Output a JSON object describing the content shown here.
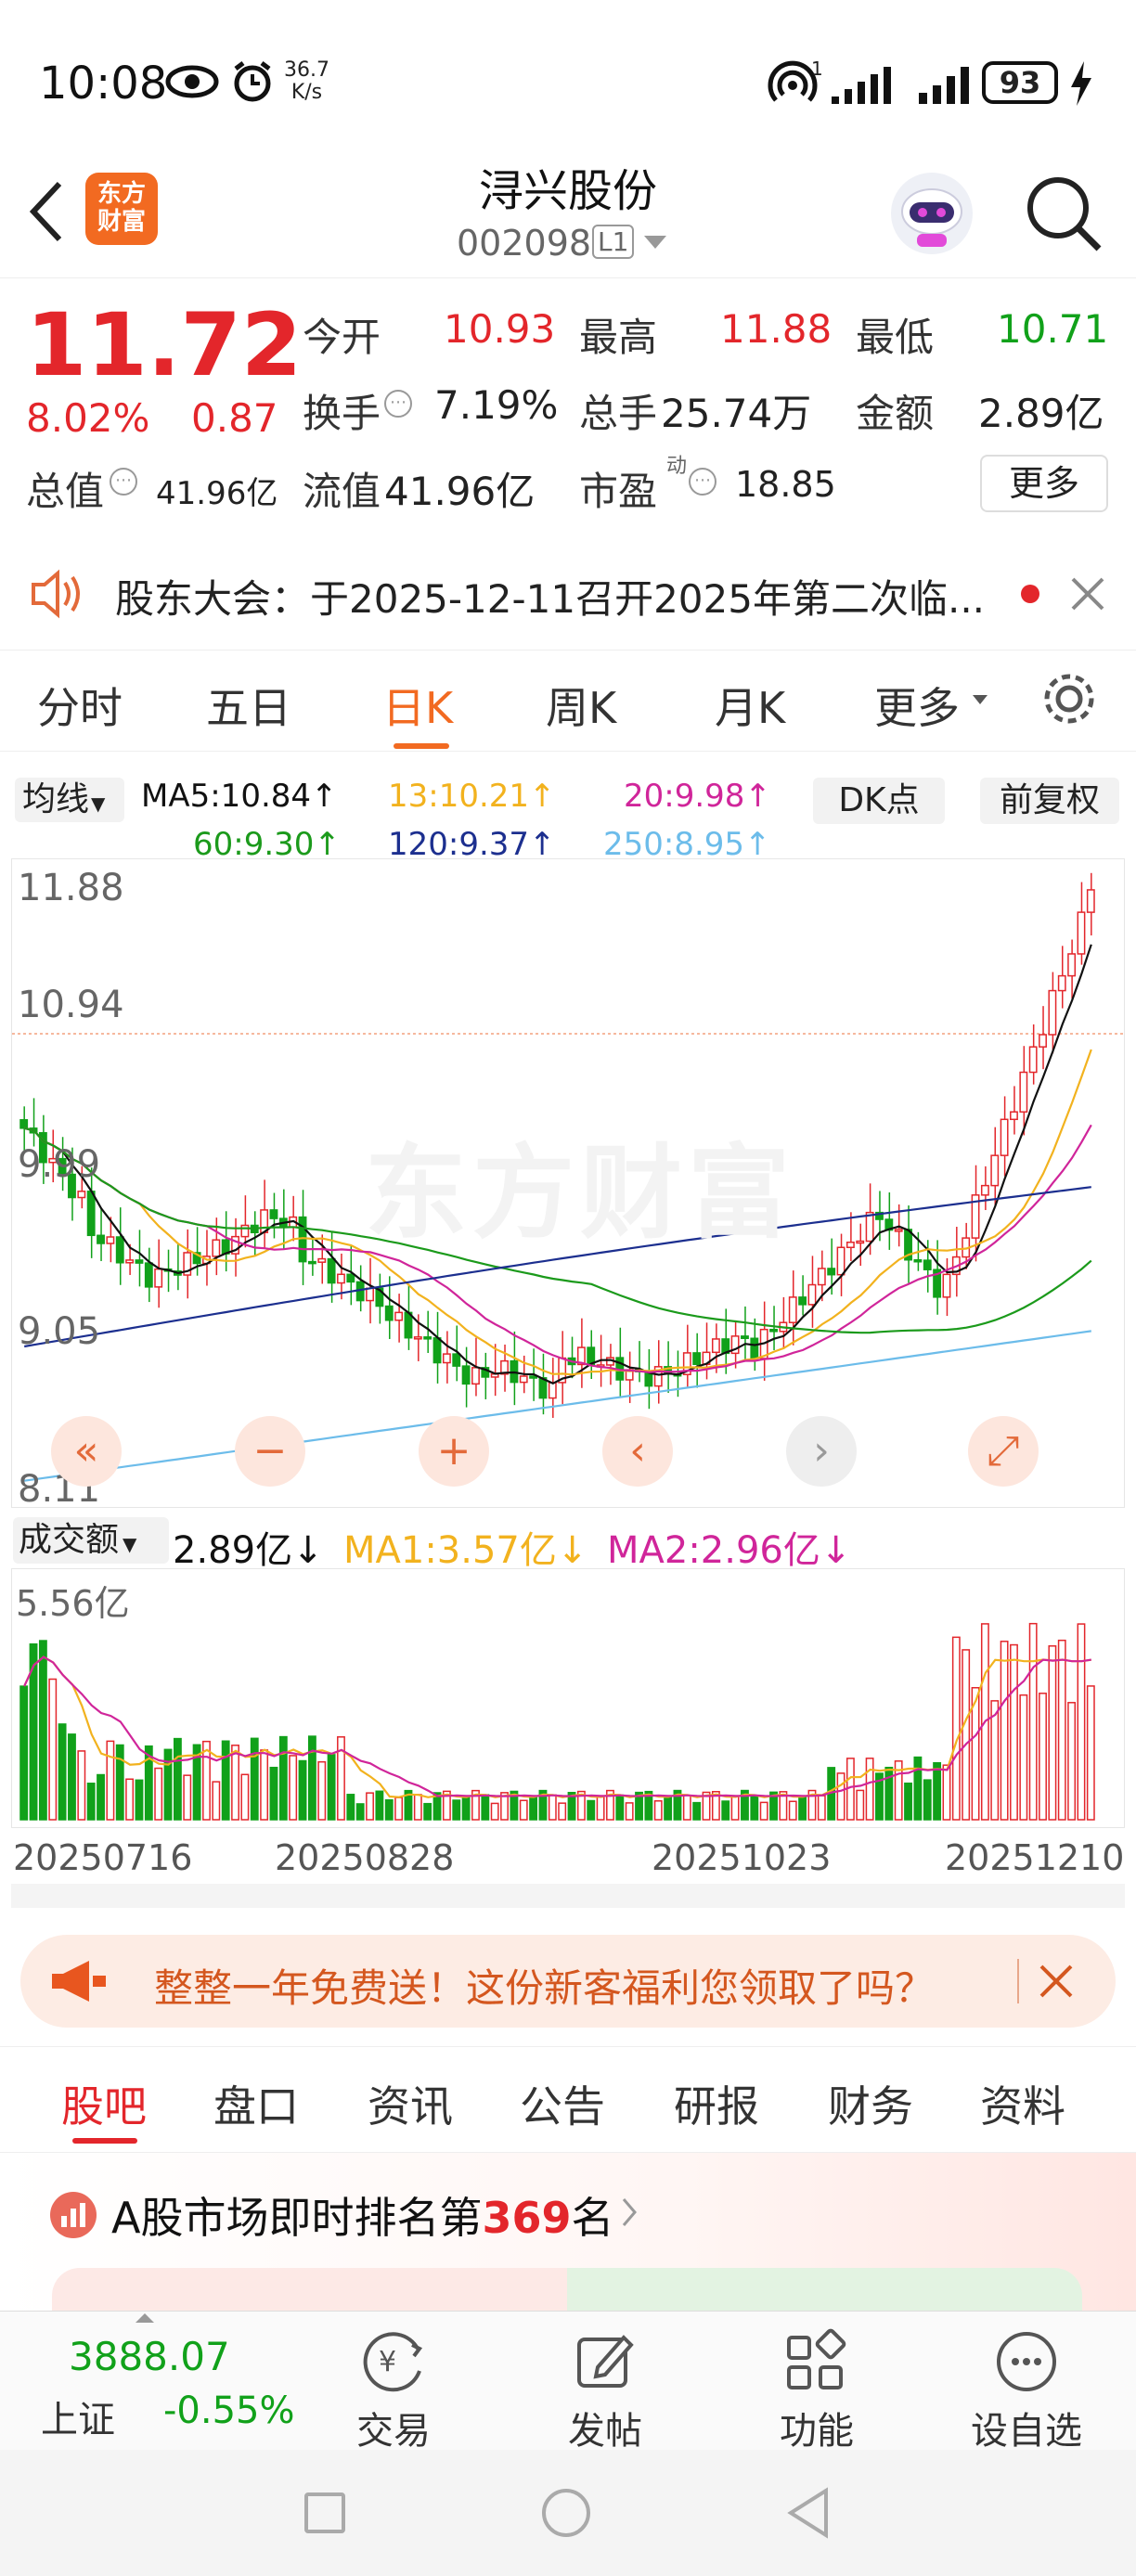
{
  "status": {
    "time": "10:08",
    "net_speed_top": "36.7",
    "net_speed_bottom": "K/s",
    "battery": "93",
    "signal_sup": "1"
  },
  "header": {
    "logo_line1": "东方",
    "logo_line2": "财富",
    "title": "浔兴股份",
    "code": "002098",
    "level": "L1"
  },
  "quote": {
    "price": "11.72",
    "pct": "8.02%",
    "change": "0.87",
    "open_label": "今开",
    "open": "10.93",
    "high_label": "最高",
    "high": "11.88",
    "low_label": "最低",
    "low": "10.71",
    "turnover_label": "换手",
    "turnover": "7.19%",
    "volume_label": "总手",
    "volume": "25.74万",
    "amount_label": "金额",
    "amount": "2.89亿",
    "mcap_label": "总值",
    "mcap": "41.96亿",
    "float_label": "流值",
    "float": "41.96亿",
    "pe_label": "市盈",
    "pe_sup": "动",
    "pe": "18.85",
    "more": "更多"
  },
  "notice": {
    "text": "股东大会：于2025-12-11召开2025年第二次临..."
  },
  "ktabs": [
    "分时",
    "五日",
    "日K",
    "周K",
    "月K",
    "更多"
  ],
  "ma": {
    "select": "均线",
    "ma5": "MA5:10.84↑",
    "ma13": "13:10.21↑",
    "ma20": "20:9.98↑",
    "ma60": "60:9.30↑",
    "ma120": "120:9.37↑",
    "ma250": "250:8.95↑",
    "dk": "DK点",
    "fq": "前复权"
  },
  "chart_data": {
    "type": "candlestick",
    "ylabels": [
      "11.88",
      "10.94",
      "9.99",
      "9.05",
      "8.11"
    ],
    "watermark": "东方财富",
    "last_close": "11.72"
  },
  "vol": {
    "select": "成交额",
    "value": "2.89亿↓",
    "ma1": "MA1:3.57亿↓",
    "ma2": "MA2:2.96亿↓",
    "top": "5.56亿",
    "dates": [
      "20250716",
      "20250828",
      "20251023",
      "20251210"
    ]
  },
  "promo": {
    "text": "整整一年免费送！这份新客福利您领取了吗？"
  },
  "ftabs": [
    "股吧",
    "盘口",
    "资讯",
    "公告",
    "研报",
    "财务",
    "资料"
  ],
  "rank": {
    "pre": "A股市场即时排名第",
    "num": "369",
    "post": "名"
  },
  "bottom": {
    "index_value": "3888.07",
    "index_name": "上证",
    "index_pct": "-0.55%",
    "trade": "交易",
    "post": "发帖",
    "func": "功能",
    "watch": "设自选"
  },
  "colors": {
    "up": "#e3262b",
    "down": "#11a11a",
    "accent": "#f26a21",
    "ma5": "#111111",
    "ma13": "#f2b21e",
    "ma20": "#d0259a",
    "ma60": "#1b9a1b",
    "ma120": "#1c2f8f",
    "ma250": "#6cbcea"
  }
}
